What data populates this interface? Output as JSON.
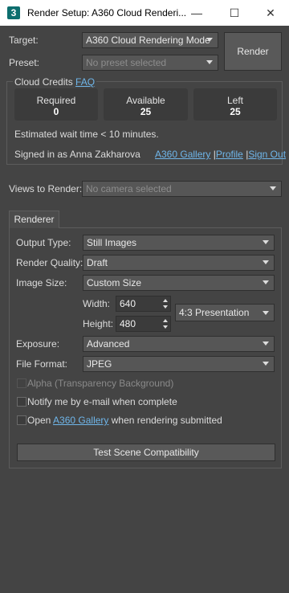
{
  "window": {
    "title": "Render Setup: A360 Cloud Renderi...",
    "app_icon": "3",
    "minimize_glyph": "—",
    "maximize_glyph": "☐",
    "close_glyph": "✕"
  },
  "target": {
    "label": "Target:",
    "value": "A360 Cloud Rendering Mode"
  },
  "preset": {
    "label": "Preset:",
    "placeholder": "No preset selected"
  },
  "render_button": "Render",
  "cloud_credits": {
    "title": "Cloud Credits",
    "faq_link": "FAQ",
    "boxes": [
      {
        "label": "Required",
        "value": "0"
      },
      {
        "label": "Available",
        "value": "25"
      },
      {
        "label": "Left",
        "value": "25"
      }
    ],
    "wait_time": "Estimated wait time < 10 minutes.",
    "signed_in": "Signed in as Anna Zakharova",
    "links": {
      "gallery": "A360 Gallery",
      "profile": "Profile",
      "sign_out": "Sign Out",
      "separator": "|"
    }
  },
  "views_to_render": {
    "label": "Views to Render:",
    "placeholder": "No camera selected"
  },
  "tabs": {
    "renderer": "Renderer"
  },
  "renderer": {
    "output_type": {
      "label": "Output Type:",
      "value": "Still Images"
    },
    "render_quality": {
      "label": "Render Quality:",
      "value": "Draft"
    },
    "image_size": {
      "label": "Image Size:",
      "value": "Custom Size"
    },
    "width": {
      "label": "Width:",
      "value": "640"
    },
    "height": {
      "label": "Height:",
      "value": "480"
    },
    "aspect": "4:3 Presentation",
    "exposure": {
      "label": "Exposure:",
      "value": "Advanced"
    },
    "file_format": {
      "label": "File Format:",
      "value": "JPEG"
    },
    "alpha": {
      "label": "Alpha (Transparency Background)",
      "checked": false,
      "enabled": false
    },
    "notify": {
      "label": "Notify me by e-mail when complete",
      "checked": false
    },
    "open_gallery": {
      "prefix": "Open",
      "link": "A360 Gallery",
      "suffix": "when rendering submitted",
      "checked": false
    },
    "test_button": "Test Scene Compatibility"
  }
}
